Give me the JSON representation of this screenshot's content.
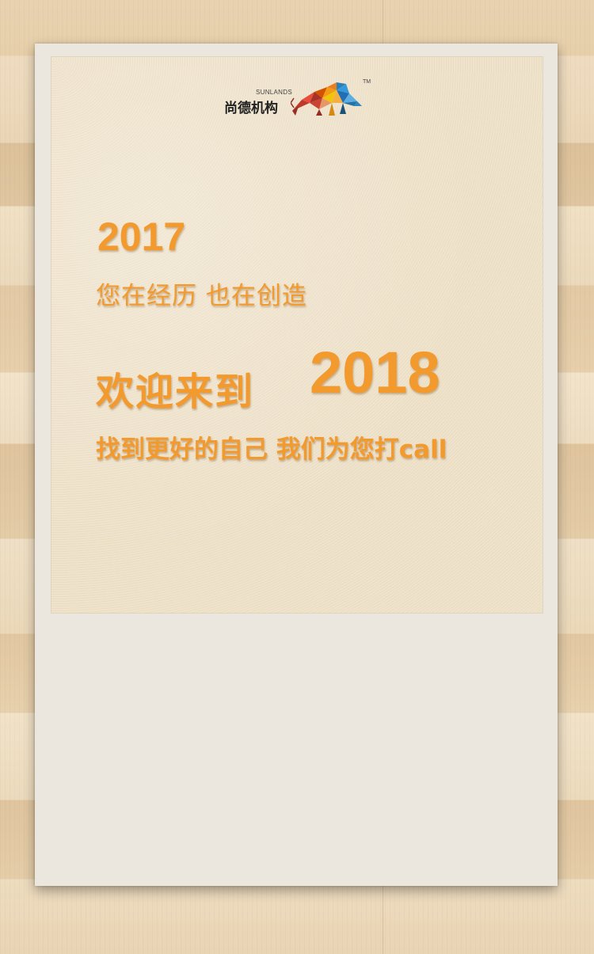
{
  "logo": {
    "name_cn": "尚德机构",
    "name_en": "SUNLANDS",
    "trademark": "TM"
  },
  "headline": {
    "year_past": "2017",
    "subtitle_past": "您在经历 也在创造",
    "welcome": "欢迎来到",
    "year_new": "2018",
    "slogan": "找到更好的自己 我们为您打call"
  },
  "colors": {
    "accent": "#f29a2e",
    "card": "#ebe7df",
    "paper": "#efe3cc"
  }
}
